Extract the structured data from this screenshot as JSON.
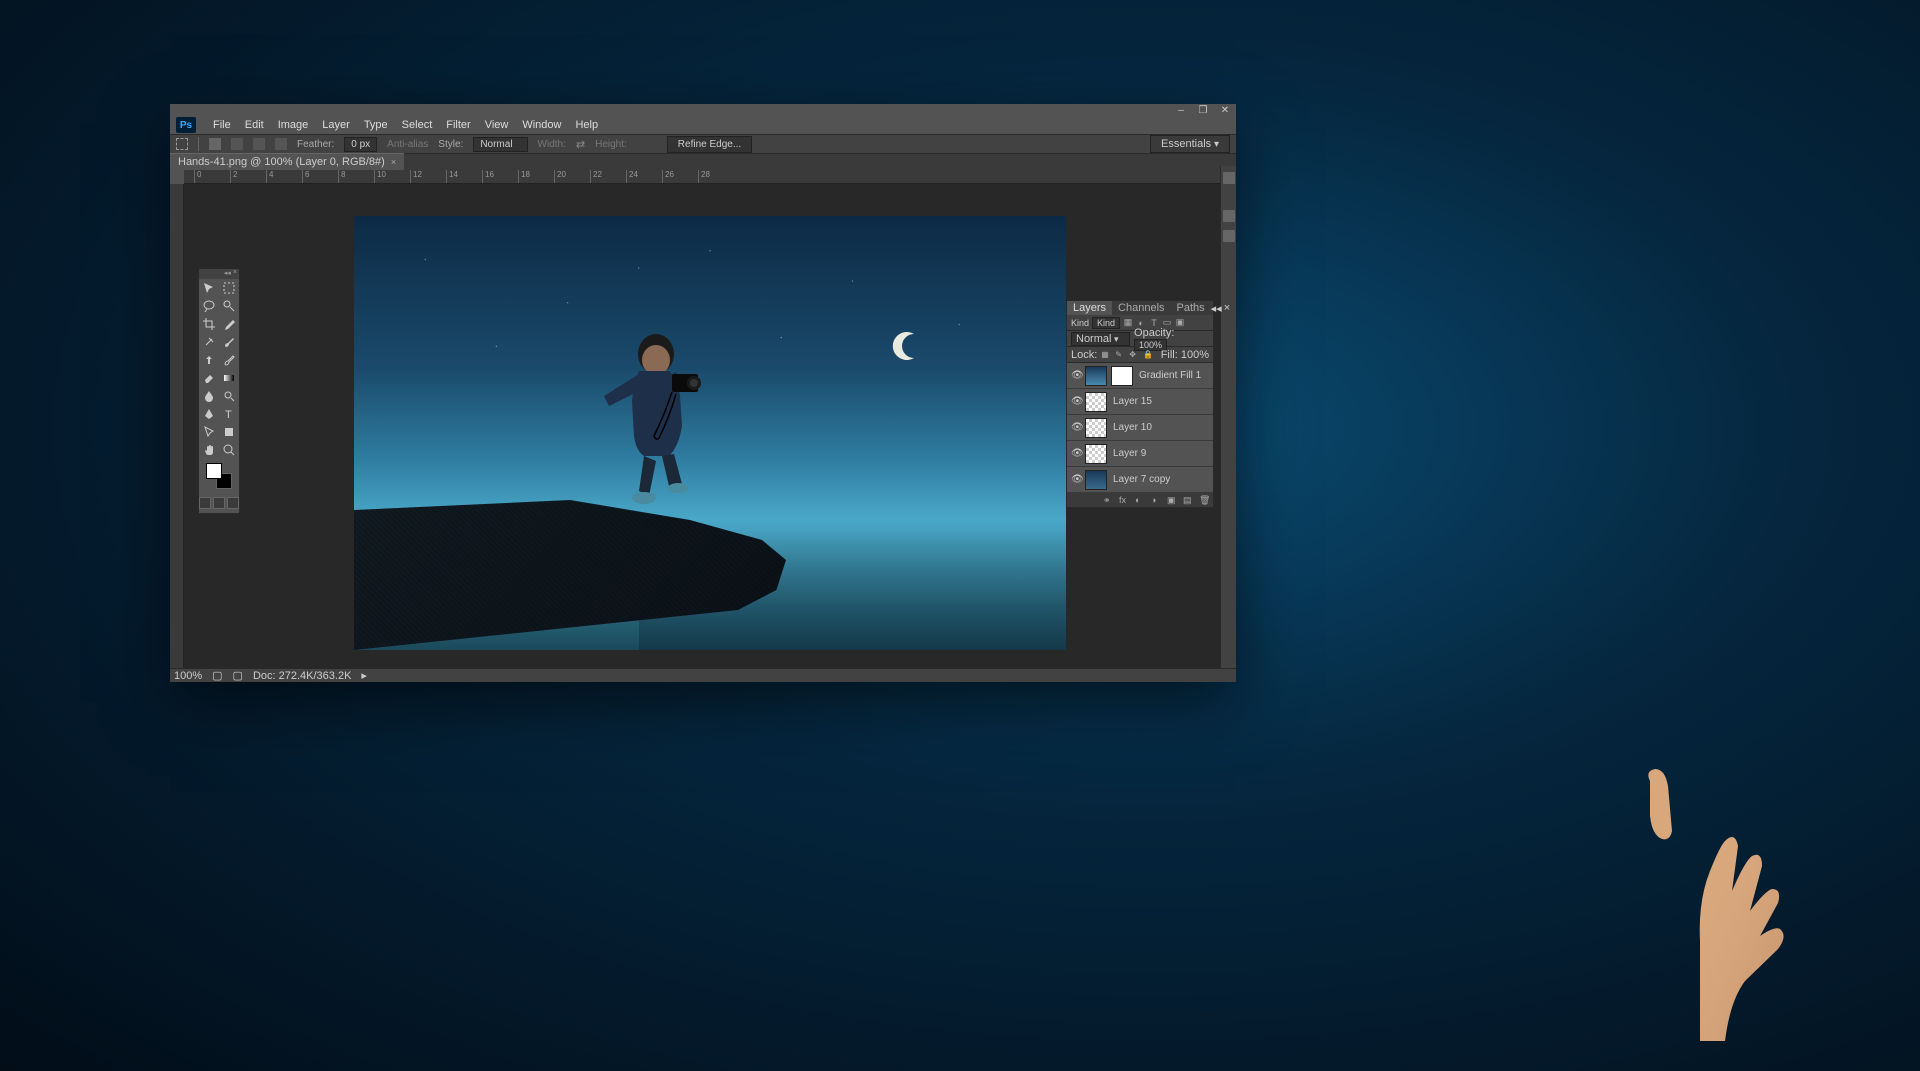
{
  "menubar": {
    "items": [
      "File",
      "Edit",
      "Image",
      "Layer",
      "Type",
      "Select",
      "Filter",
      "View",
      "Window",
      "Help"
    ]
  },
  "optionsbar": {
    "feather_label": "Feather:",
    "feather_value": "0 px",
    "antialias": "Anti-alias",
    "style_label": "Style:",
    "style_value": "Normal",
    "width_label": "Width:",
    "height_label": "Height:",
    "refine": "Refine Edge...",
    "workspace": "Essentials"
  },
  "tab": {
    "title": "Hands-41.png @ 100% (Layer 0, RGB/8#)"
  },
  "ruler_ticks": [
    "0",
    "2",
    "4",
    "6",
    "8",
    "10",
    "12",
    "14",
    "16",
    "18",
    "20",
    "22",
    "24",
    "26",
    "28"
  ],
  "tools": [
    "move-tool",
    "marquee-tool",
    "lasso-tool",
    "quick-select-tool",
    "crop-tool",
    "eyedropper-tool",
    "healing-brush-tool",
    "brush-tool",
    "clone-stamp-tool",
    "history-brush-tool",
    "eraser-tool",
    "gradient-tool",
    "blur-tool",
    "dodge-tool",
    "pen-tool",
    "type-tool",
    "path-select-tool",
    "shape-tool",
    "hand-tool",
    "zoom-tool"
  ],
  "layers_panel": {
    "tabs": [
      "Layers",
      "Channels",
      "Paths"
    ],
    "kind_label": "Kind",
    "blend_mode": "Normal",
    "opacity_label": "Opacity:",
    "opacity_value": "100%",
    "lock_label": "Lock:",
    "fill_label": "Fill:",
    "fill_value": "100%",
    "layers": [
      {
        "name": "Gradient Fill 1",
        "has_mask": true,
        "thumb": "gradient"
      },
      {
        "name": "Layer 15",
        "thumb": "transparent"
      },
      {
        "name": "Layer 10",
        "thumb": "transparent"
      },
      {
        "name": "Layer 9",
        "thumb": "transparent"
      },
      {
        "name": "Layer 7 copy",
        "thumb": "image"
      }
    ],
    "footer_icons": [
      "link-icon",
      "fx-icon",
      "mask-icon",
      "adjustment-icon",
      "group-icon",
      "new-layer-icon",
      "trash-icon"
    ]
  },
  "statusbar": {
    "zoom": "100%",
    "doc": "Doc: 272.4K/363.2K"
  },
  "window_controls": {
    "minimize": "–",
    "maximize": "❐",
    "close": "✕"
  }
}
